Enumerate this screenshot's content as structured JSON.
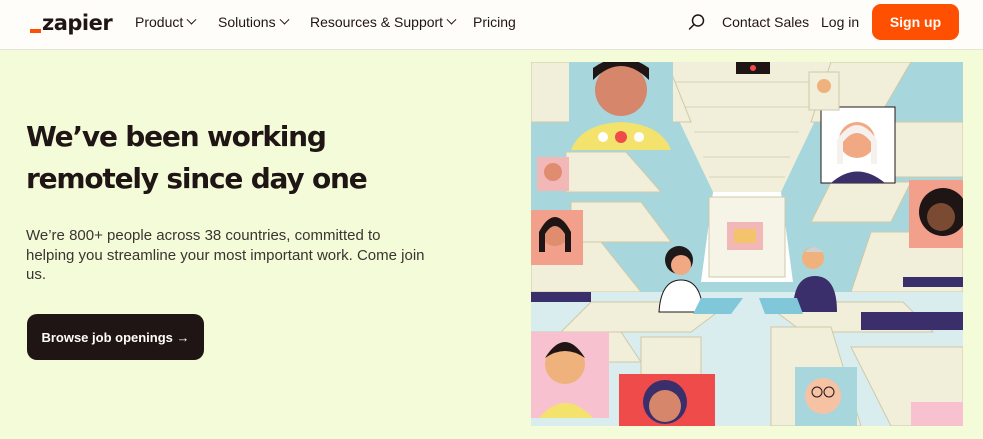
{
  "brand": {
    "name": "zapier",
    "accent": "#ff4f00",
    "background": "#f3fbd9",
    "dark": "#201515"
  },
  "nav": {
    "items": [
      {
        "label": "Product",
        "has_dropdown": true
      },
      {
        "label": "Solutions",
        "has_dropdown": true
      },
      {
        "label": "Resources & Support",
        "has_dropdown": true
      },
      {
        "label": "Pricing",
        "has_dropdown": false
      }
    ],
    "search_icon": "search-icon",
    "contact_sales": "Contact Sales",
    "login": "Log in",
    "signup": "Sign up"
  },
  "hero": {
    "title": "We’ve been working remotely since day one",
    "description": "We’re 800+ people across 38 countries, committed to helping you streamline your most important work. Come join us.",
    "cta": "Browse job openings →"
  },
  "illustration": {
    "subject": "remote-office-video-call-illustration"
  }
}
